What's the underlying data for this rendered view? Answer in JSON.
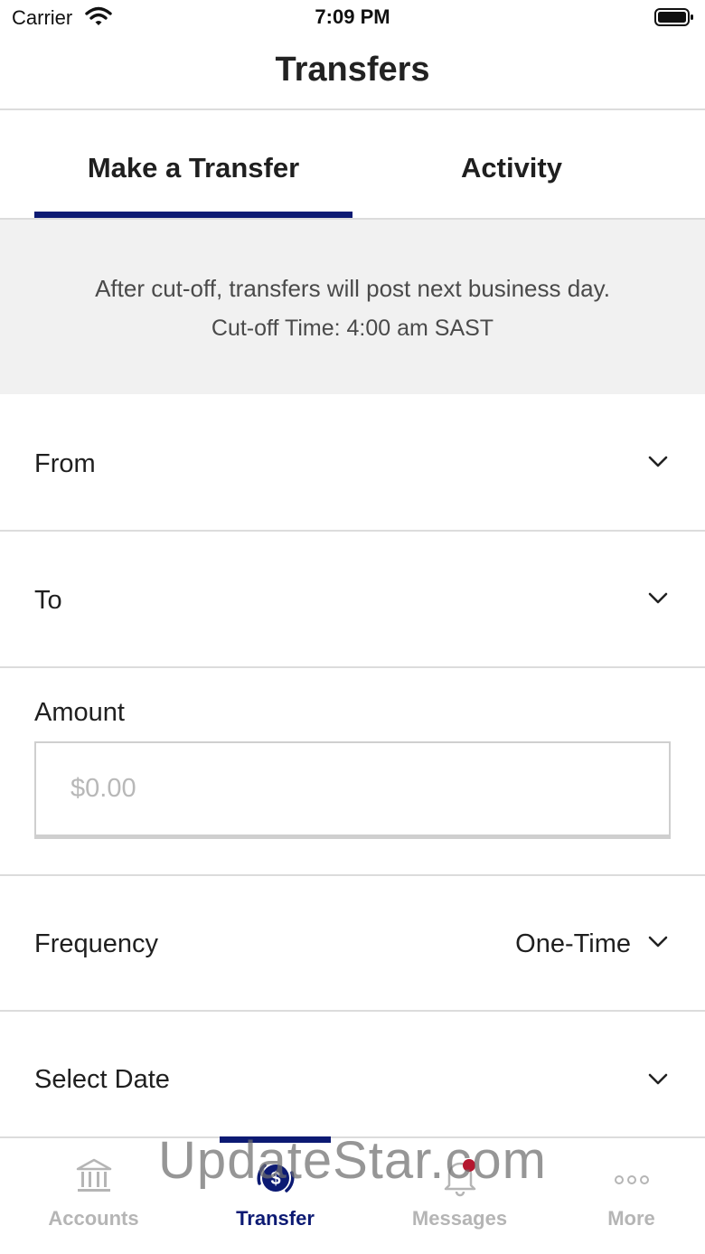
{
  "status_bar": {
    "carrier": "Carrier",
    "time": "7:09 PM"
  },
  "nav": {
    "title": "Transfers"
  },
  "tabs": [
    {
      "label": "Make a Transfer",
      "active": true
    },
    {
      "label": "Activity",
      "active": false
    }
  ],
  "notice": {
    "line1": "After cut-off, transfers will post next business day.",
    "line2": "Cut-off Time: 4:00 am SAST"
  },
  "form": {
    "from_label": "From",
    "to_label": "To",
    "amount_label": "Amount",
    "amount_placeholder": "$0.00",
    "amount_value": "",
    "frequency_label": "Frequency",
    "frequency_value": "One-Time",
    "date_label": "Select Date"
  },
  "tabbar": {
    "items": [
      {
        "label": "Accounts",
        "icon": "bank-icon",
        "active": false
      },
      {
        "label": "Transfer",
        "icon": "transfer-dollar-icon",
        "active": true
      },
      {
        "label": "Messages",
        "icon": "bell-icon",
        "active": false
      },
      {
        "label": "More",
        "icon": "more-dots-icon",
        "active": false
      }
    ]
  },
  "watermark": "UpdateStar.com",
  "colors": {
    "accent": "#0c1a73",
    "notice_bg": "#f1f1f1",
    "inactive_tab": "#b5b5b5",
    "badge": "#b5172f"
  }
}
